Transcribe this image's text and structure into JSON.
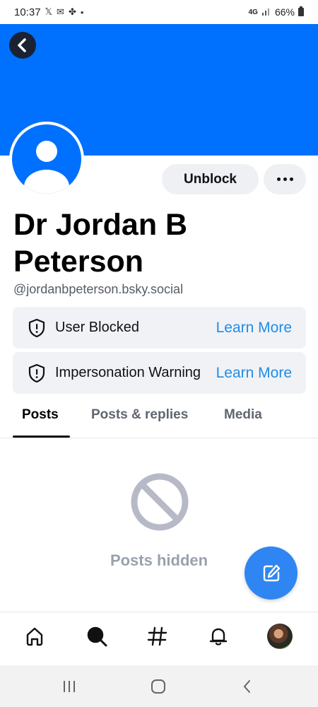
{
  "status_bar": {
    "time": "10:37",
    "network": "4G",
    "battery": "66%"
  },
  "profile": {
    "display_name": "Dr Jordan B Peterson",
    "handle": "@jordanbpeterson.bsky.social",
    "banner_color": "#0070ff"
  },
  "actions": {
    "unblock_label": "Unblock"
  },
  "alerts": [
    {
      "label": "User Blocked",
      "link": "Learn More"
    },
    {
      "label": "Impersonation Warning",
      "link": "Learn More"
    }
  ],
  "tabs": [
    {
      "label": "Posts",
      "active": true
    },
    {
      "label": "Posts & replies",
      "active": false
    },
    {
      "label": "Media",
      "active": false
    }
  ],
  "feed": {
    "empty_label": "Posts hidden"
  },
  "colors": {
    "accent": "#1e8de8",
    "fab": "#2f86f2",
    "alert_bg": "#f1f2f6"
  },
  "icons": {
    "back": "chevron-left-icon",
    "more": "ellipsis-icon",
    "shield": "shield-alert-icon",
    "hidden": "no-entry-icon",
    "compose": "compose-icon",
    "home": "home-icon",
    "search": "search-icon",
    "feeds": "hashtag-icon",
    "notifications": "bell-icon",
    "profile": "avatar-icon"
  }
}
